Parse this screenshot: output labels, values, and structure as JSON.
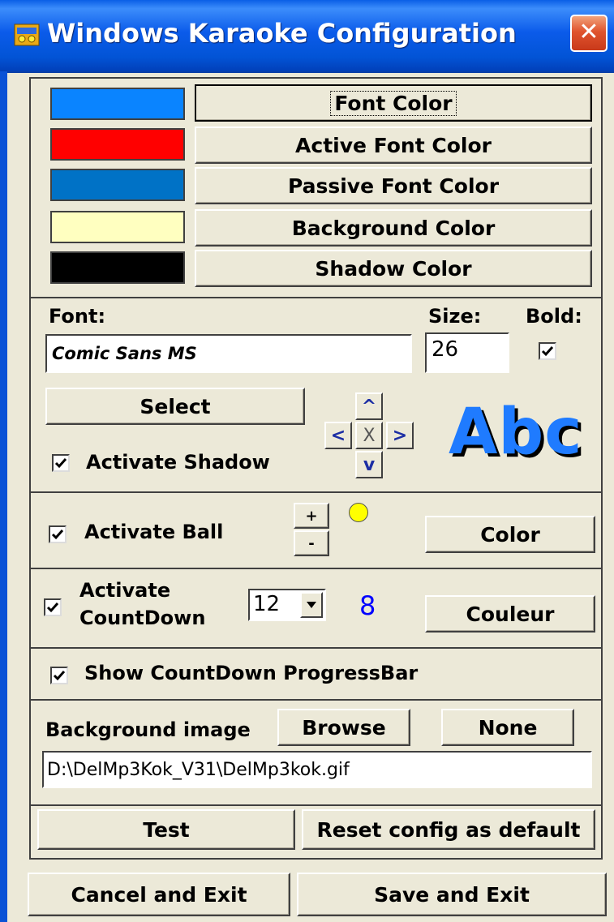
{
  "window": {
    "title": "Windows Karaoke Configuration",
    "close_glyph": "✕"
  },
  "colors": {
    "font": "#0a84ff",
    "active_font": "#ff0000",
    "passive_font": "#0072c6",
    "background": "#ffffc0",
    "shadow": "#000000",
    "ball": "#ffff00"
  },
  "color_buttons": {
    "font_color": "Font Color",
    "active_font_color": "Active Font Color",
    "passive_font_color": "Passive Font Color",
    "background_color": "Background Color",
    "shadow_color": "Shadow Color"
  },
  "font_section": {
    "font_label": "Font:",
    "font_value": "Comic Sans MS",
    "size_label": "Size:",
    "size_value": "26",
    "bold_label": "Bold:",
    "bold_checked": true,
    "select_button": "Select",
    "activate_shadow": "Activate Shadow",
    "activate_shadow_checked": true,
    "shadow_nav": {
      "up": "^",
      "left": "<",
      "center": "X",
      "right": ">",
      "down": "v"
    },
    "preview_text": "Abc"
  },
  "ball_section": {
    "activate_ball": "Activate Ball",
    "checked": true,
    "plus": "+",
    "minus": "-",
    "color_button": "Color"
  },
  "countdown_section": {
    "activate_countdown_line1": "Activate",
    "activate_countdown_line2": "CountDown",
    "checked": true,
    "select_value": "12",
    "countdown_value": "8",
    "couleur_button": "Couleur"
  },
  "progress_section": {
    "label": "Show CountDown ProgressBar",
    "checked": true
  },
  "background_section": {
    "label": "Background image",
    "browse_button": "Browse",
    "none_button": "None",
    "path": "D:\\DelMp3Kok_V31\\DelMp3kok.gif"
  },
  "actions": {
    "test": "Test",
    "reset": "Reset config as default",
    "cancel": "Cancel and Exit",
    "save": "Save and Exit"
  }
}
